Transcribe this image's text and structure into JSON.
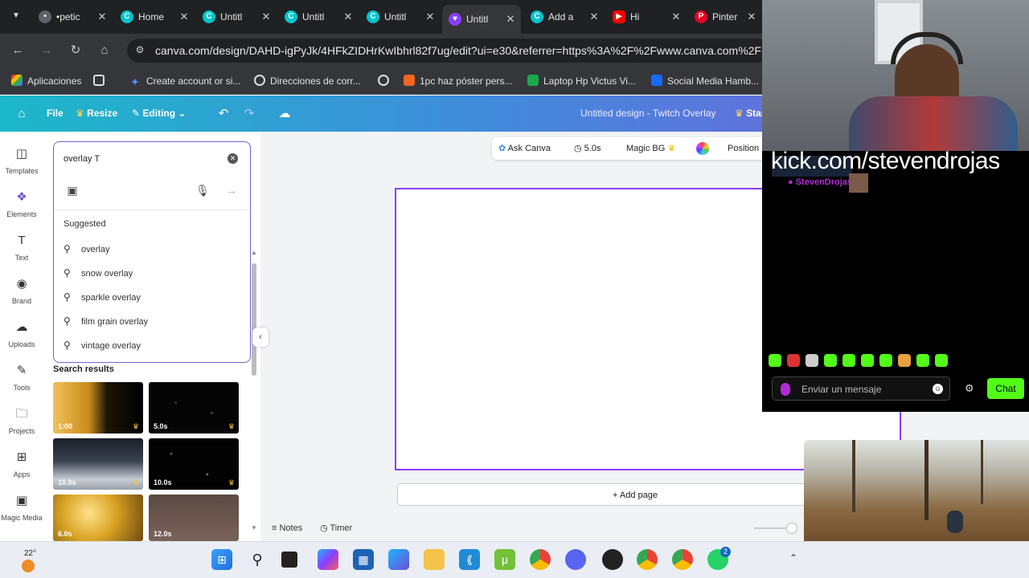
{
  "browser": {
    "tabs": [
      {
        "title": "•petic",
        "icon": "bullet-icon",
        "color": "#5f6368"
      },
      {
        "title": "Home",
        "icon": "canva-icon",
        "color": "#00c4cc"
      },
      {
        "title": "Untitl",
        "icon": "canva-icon",
        "color": "#00c4cc"
      },
      {
        "title": "Untitl",
        "icon": "canva-icon",
        "color": "#00c4cc"
      },
      {
        "title": "Untitl",
        "icon": "canva-icon",
        "color": "#00c4cc"
      },
      {
        "title": "Untitl",
        "icon": "heart-icon",
        "color": "#8b3dff",
        "active": true
      },
      {
        "title": "Add a",
        "icon": "canva-icon",
        "color": "#00c4cc"
      },
      {
        "title": "Hi",
        "icon": "youtube-icon",
        "color": "#ff0000"
      },
      {
        "title": "Pinter",
        "icon": "pinterest-icon",
        "color": "#e60023"
      }
    ],
    "url": "canva.com/design/DAHD-igPyJk/4HFkZIDHrKwIbhrl82f7ug/edit?ui=e30&referrer=https%3A%2F%2Fwww.canva.com%2F",
    "bookmarks": [
      {
        "label": "Aplicaciones",
        "icon": "apps-grid-icon"
      },
      {
        "label": "",
        "icon": "grid-icon"
      },
      {
        "label": "Create account or si...",
        "icon": "star-icon"
      },
      {
        "label": "Direcciones de corr...",
        "icon": "mail-icon"
      },
      {
        "label": "",
        "icon": "globe-icon"
      },
      {
        "label": "1pc haz póster pers...",
        "icon": "poster-icon"
      },
      {
        "label": "Laptop Hp Victus Vi...",
        "icon": "px-icon"
      },
      {
        "label": "Social Media Hamb...",
        "icon": "behance-icon"
      }
    ]
  },
  "canva_header": {
    "file": "File",
    "resize": "Resize",
    "editing": "Editing",
    "design_title": "Untitled design - Twitch Overlay",
    "share": "Star"
  },
  "rail": [
    {
      "label": "Templates",
      "icon": "templates-icon"
    },
    {
      "label": "Elements",
      "icon": "elements-icon",
      "active": true
    },
    {
      "label": "Text",
      "icon": "text-icon"
    },
    {
      "label": "Brand",
      "icon": "brand-icon"
    },
    {
      "label": "Uploads",
      "icon": "uploads-icon"
    },
    {
      "label": "Tools",
      "icon": "tools-icon"
    },
    {
      "label": "Projects",
      "icon": "projects-icon"
    },
    {
      "label": "Apps",
      "icon": "apps-icon"
    },
    {
      "label": "Magic Media",
      "icon": "magic-media-icon"
    }
  ],
  "search": {
    "value": "overlay T",
    "suggested_heading": "Suggested",
    "suggestions": [
      "overlay",
      "snow overlay",
      "sparkle overlay",
      "film grain overlay",
      "vintage overlay"
    ],
    "results_heading": "Search results",
    "results": [
      {
        "duration": "1:00"
      },
      {
        "duration": "5.0s"
      },
      {
        "duration": "10.0s"
      },
      {
        "duration": "10.0s"
      },
      {
        "duration": "6.0s"
      },
      {
        "duration": "12.0s"
      }
    ]
  },
  "context_bar": {
    "ask_canva": "Ask Canva",
    "duration": "5.0s",
    "magic_bg": "Magic BG",
    "position": "Position"
  },
  "canvas": {
    "add_page": "+ Add page",
    "notes": "Notes",
    "timer": "Timer"
  },
  "stream": {
    "kick_url": "kick.com/stevendrojas",
    "chat_user": "StevenDrojas:",
    "chat_placeholder": "Enviar un mensaje",
    "chat_button": "Chat",
    "accent": "#53fc18"
  },
  "taskbar": {
    "temperature": "22°",
    "whatsapp_badge": "2",
    "apps": [
      "windows-start-icon",
      "search-icon",
      "task-view-icon",
      "m365-icon",
      "store-icon",
      "copilot-icon",
      "file-explorer-icon",
      "vscode-icon",
      "utorrent-icon",
      "chrome-icon",
      "discord-icon",
      "recorder-icon",
      "chrome-profile-icon",
      "chrome-profile-icon",
      "whatsapp-icon"
    ]
  }
}
